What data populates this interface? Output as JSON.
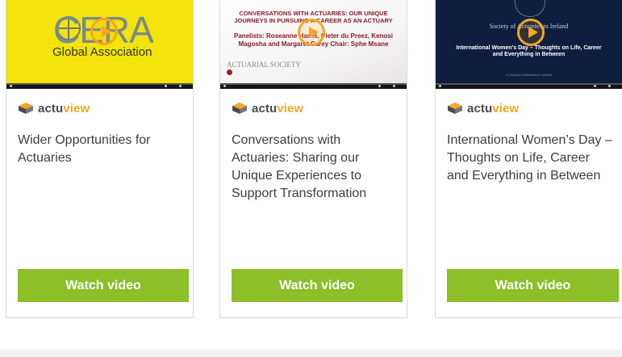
{
  "thumbnails": {
    "cera": {
      "logo": "CERA",
      "subtitle": "Global Association"
    },
    "conversations": {
      "headline": "CONVERSATIONS WITH ACTUARIES: OUR UNIQUE JOURNEYS IN PURSUING A CAREER AS AN ACTUARY",
      "panel": "Panelists: Roseanne Harris, Pieter du Preez, Kenosi Magosha and Margaret Carey Chair: Sphe Msane",
      "brand": "ACTUARIAL SOCIETY"
    },
    "iwd": {
      "society": "Society of Actuaries in Ireland",
      "title": "International Women's Day – Thoughts on Life, Career and Everything in Between",
      "footer": "© Society of Actuaries in Ireland"
    }
  },
  "brand": {
    "part1": "actu",
    "part2": "view"
  },
  "cards": [
    {
      "title": "Wider Opportunities for Actuaries",
      "button": "Watch video"
    },
    {
      "title": "Conversations with Actuaries: Sharing our Unique Experiences to Support Transformation",
      "button": "Watch video"
    },
    {
      "title": "International Women’s Day – Thoughts on Life, Career and Everything in Between",
      "button": "Watch video"
    }
  ],
  "colors": {
    "button": "#8cbf28",
    "accent": "#f5a623"
  }
}
